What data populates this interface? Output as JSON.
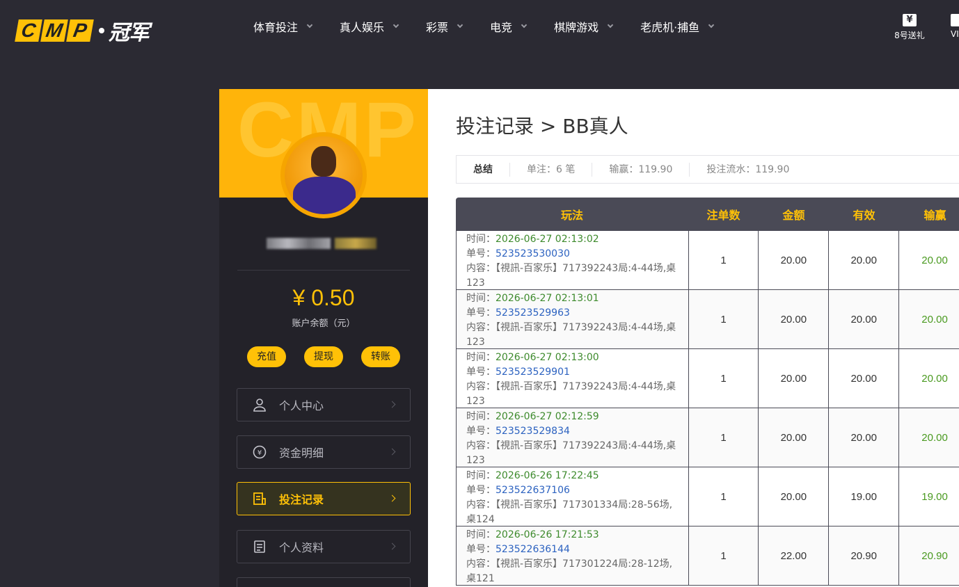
{
  "logo": {
    "letters": [
      "C",
      "M",
      "P"
    ],
    "cn": "冠军"
  },
  "nav": [
    {
      "label": "体育投注"
    },
    {
      "label": "真人娱乐"
    },
    {
      "label": "彩票"
    },
    {
      "label": "电竞"
    },
    {
      "label": "棋牌游戏"
    },
    {
      "label": "老虎机·捕鱼"
    }
  ],
  "gift": {
    "icon": "¥",
    "label": "8号送礼"
  },
  "vip_edge": "VI",
  "sidebar": {
    "watermark": "CMP",
    "balance": "¥ 0.50",
    "balance_label": "账户余额（元）",
    "buttons": [
      "充值",
      "提现",
      "转账"
    ],
    "menu": [
      {
        "label": "个人中心",
        "icon": "user-icon"
      },
      {
        "label": "资金明细",
        "icon": "money-cycle-icon"
      },
      {
        "label": "投注记录",
        "icon": "bet-record-icon"
      },
      {
        "label": "个人资料",
        "icon": "profile-doc-icon"
      }
    ]
  },
  "main": {
    "title": "投注记录 > BB真人",
    "summary": {
      "title": "总结",
      "bets": "单注：6 笔",
      "win_loss": "输赢：119.90",
      "turnover": "投注流水：119.90"
    },
    "table": {
      "headers": [
        "玩法",
        "注单数",
        "金额",
        "有效",
        "输赢"
      ],
      "label_time": "时间：",
      "label_id": "单号：",
      "label_content": "内容：",
      "rows": [
        {
          "time": "2026-06-27 02:13:02",
          "id": "523523530030",
          "content": "【視訊-百家乐】717392243局:4-44场,桌123",
          "count": "1",
          "amount": "20.00",
          "valid": "20.00",
          "win": "20.00"
        },
        {
          "time": "2026-06-27 02:13:01",
          "id": "523523529963",
          "content": "【視訊-百家乐】717392243局:4-44场,桌123",
          "count": "1",
          "amount": "20.00",
          "valid": "20.00",
          "win": "20.00"
        },
        {
          "time": "2026-06-27 02:13:00",
          "id": "523523529901",
          "content": "【視訊-百家乐】717392243局:4-44场,桌123",
          "count": "1",
          "amount": "20.00",
          "valid": "20.00",
          "win": "20.00"
        },
        {
          "time": "2026-06-27 02:12:59",
          "id": "523523529834",
          "content": "【視訊-百家乐】717392243局:4-44场,桌123",
          "count": "1",
          "amount": "20.00",
          "valid": "20.00",
          "win": "20.00"
        },
        {
          "time": "2026-06-26 17:22:45",
          "id": "523522637106",
          "content": "【視訊-百家乐】717301334局:28-56场,桌124",
          "count": "1",
          "amount": "20.00",
          "valid": "19.00",
          "win": "19.00"
        },
        {
          "time": "2026-06-26 17:21:53",
          "id": "523522636144",
          "content": "【視訊-百家乐】717301224局:28-12场,桌121",
          "count": "1",
          "amount": "22.00",
          "valid": "20.90",
          "win": "20.90"
        }
      ]
    }
  },
  "colors": {
    "accent": "#ffc107",
    "bg": "#2b2a33",
    "sidebar": "#232229",
    "win_green": "#4a9a20",
    "id_blue": "#2c62c0"
  }
}
